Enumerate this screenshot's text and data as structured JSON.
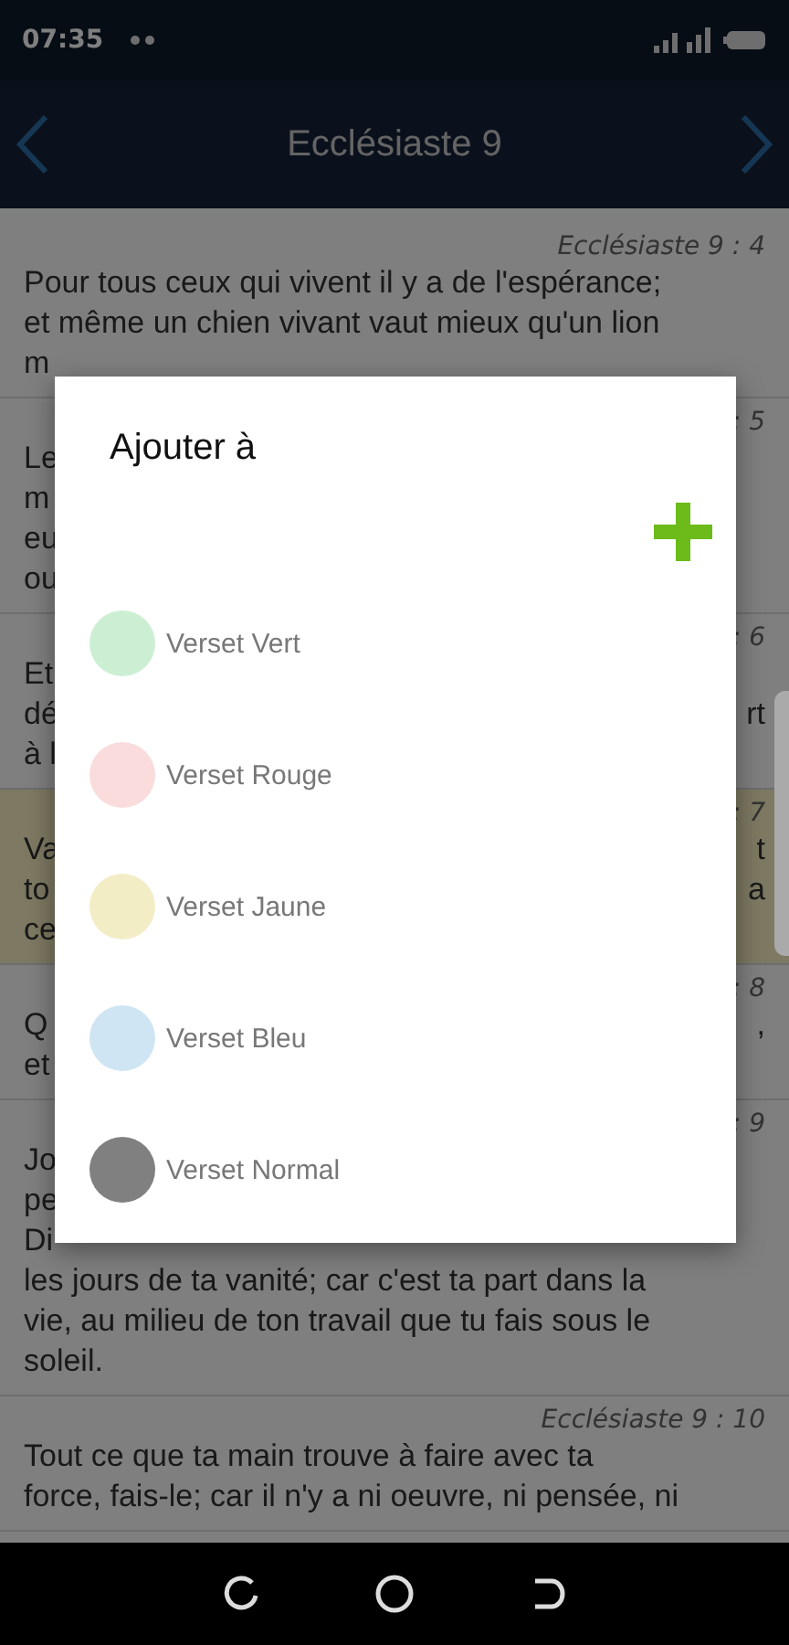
{
  "status_bar": {
    "time": "07:35"
  },
  "header": {
    "title": "Ecclésiaste 9"
  },
  "verses": [
    {
      "ref": "Ecclésiaste 9 : 4",
      "lines": [
        {
          "left": "Pour tous ceux qui vivent il y a de l'espérance;"
        },
        {
          "left": "et même un chien vivant vaut mieux qu'un lion"
        },
        {
          "left": "m"
        }
      ]
    },
    {
      "ref": ": 5",
      "lines": [
        {
          "left": "Le"
        },
        {
          "left": "m"
        },
        {
          "left": "eu"
        },
        {
          "left": "ou"
        }
      ]
    },
    {
      "ref": ": 6",
      "lines": [
        {
          "left": "Et"
        },
        {
          "left": "dé",
          "right": "rt"
        },
        {
          "left": "à l"
        }
      ]
    },
    {
      "ref": ": 7",
      "color": "#fbf3c4",
      "lines": [
        {
          "left": "Va",
          "right": "t"
        },
        {
          "left": "to",
          "right": "a"
        },
        {
          "left": "ce"
        }
      ]
    },
    {
      "ref": ": 8",
      "lines": [
        {
          "left": "Q",
          "right": ","
        },
        {
          "left": "et"
        }
      ]
    },
    {
      "ref": ": 9",
      "lines": [
        {
          "left": "Jo"
        },
        {
          "left": "pe"
        },
        {
          "left": "Di"
        },
        {
          "left": "les jours de ta vanité; car c'est ta part dans la"
        },
        {
          "left": "vie, au milieu de ton travail que tu fais sous le"
        },
        {
          "left": "soleil."
        }
      ]
    },
    {
      "ref": "Ecclésiaste 9 : 10",
      "lines": [
        {
          "left": "Tout ce que ta main trouve à faire avec ta"
        },
        {
          "left": "force, fais-le; car il n'y a ni oeuvre, ni pensée, ni"
        }
      ]
    }
  ],
  "dialog": {
    "title": "Ajouter à",
    "options": [
      {
        "label": "Verset Vert",
        "color": "#ccefd3"
      },
      {
        "label": "Verset Rouge",
        "color": "#fadcdc"
      },
      {
        "label": "Verset Jaune",
        "color": "#f3edc6"
      },
      {
        "label": "Verset Bleu",
        "color": "#cfe5f3"
      },
      {
        "label": "Verset Normal",
        "color": "#808080"
      }
    ]
  }
}
